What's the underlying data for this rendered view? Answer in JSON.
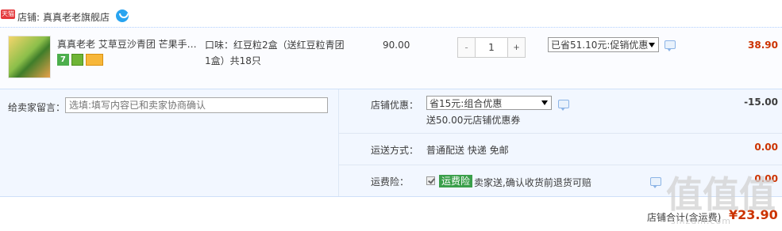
{
  "shop": {
    "tmall_badge": "天猫",
    "label": "店铺:",
    "name": "真真老老旗舰店"
  },
  "item": {
    "title": "真真老老 艾草豆沙青团 芒果手…",
    "badge_7": "7",
    "sku": "口味：红豆粒2盒（送红豆粒青团1盒）共18只",
    "price": "90.00",
    "quantity": "1",
    "qty_minus": "-",
    "qty_plus": "+",
    "promo_selected": "已省51.10元:促销优惠",
    "subtotal": "38.90"
  },
  "message": {
    "label": "给卖家留言：",
    "placeholder": "选填:填写内容已和卖家协商确认"
  },
  "discount": {
    "label": "店铺优惠：",
    "selected": "省15元:组合优惠",
    "note": "送50.00元店铺优惠券",
    "amount": "-15.00"
  },
  "shipping": {
    "label": "运送方式：",
    "method": "普通配送 快递 免邮",
    "amount": "0.00"
  },
  "insurance": {
    "label": "运费险：",
    "badge": "运费险",
    "text": "卖家送,确认收货前退货可赔",
    "amount": "0.00"
  },
  "footer": {
    "total_label": "店铺合计(含运费)",
    "total": "¥23.90"
  },
  "watermark": {
    "chars": [
      "值",
      "值",
      "值"
    ],
    "url": "smzdm.com"
  },
  "colors": {
    "price_red": "#cc3300",
    "panel_bg": "#f2f7ff",
    "insurance_green": "#3a9f4a"
  }
}
